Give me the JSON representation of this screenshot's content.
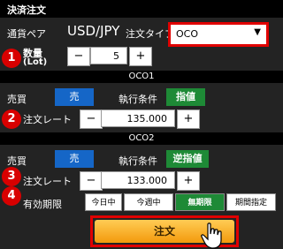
{
  "title": "決済注文",
  "pair_label": "通貨ペア",
  "pair_value": "USD/JPY",
  "order_type_label": "注文タイプ",
  "order_type_value": "OCO",
  "qty_label_line1": "数量",
  "qty_label_line2": "(Lot)",
  "qty_value": "5",
  "minus": "−",
  "plus": "+",
  "badges": [
    "1",
    "2",
    "3",
    "4"
  ],
  "oco1": {
    "header": "OCO1",
    "side_label": "売買",
    "side_value": "売",
    "cond_label": "執行条件",
    "cond_value": "指値",
    "rate_label": "注文レート",
    "rate_value": "135.000"
  },
  "oco2": {
    "header": "OCO2",
    "side_label": "売買",
    "side_value": "売",
    "cond_label": "執行条件",
    "cond_value": "逆指値",
    "rate_label": "注文レート",
    "rate_value": "133.000"
  },
  "expiry_label": "有効期限",
  "expiry_options": [
    "今日中",
    "今週中",
    "無期限",
    "期間指定"
  ],
  "expiry_selected": "無期限",
  "order_button": "注文",
  "colors": {
    "highlight": "#e00000",
    "blue": "#1566c7",
    "green": "#1e8a36",
    "orange": "#f39a0c"
  }
}
